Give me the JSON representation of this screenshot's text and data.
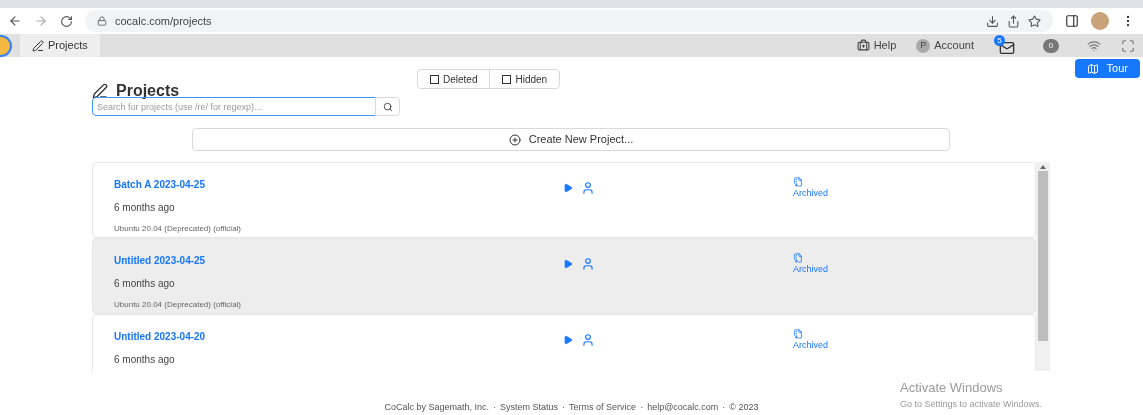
{
  "browser": {
    "url": "cocalc.com/projects"
  },
  "app_bar": {
    "tab": "Projects",
    "help": "Help",
    "account_initial": "P",
    "account": "Account",
    "mail_count": "5",
    "badge": "0"
  },
  "tour_button": "Tour",
  "page": {
    "title": "Projects",
    "search": {
      "placeholder": "Search for projects (use /re/ for regexp)..."
    },
    "filters": [
      {
        "label": "Deleted",
        "checked": false
      },
      {
        "label": "Hidden",
        "checked": false
      }
    ],
    "create_button": "Create New Project..."
  },
  "projects": [
    {
      "title": "Batch A 2023-04-25",
      "modified": "6 months ago",
      "image": "Ubuntu 20.04 (Deprecated) (official)",
      "status": "Archived",
      "selected": false
    },
    {
      "title": "Untitled 2023-04-25",
      "modified": "6 months ago",
      "image": "Ubuntu 20.04 (Deprecated) (official)",
      "status": "Archived",
      "selected": true
    },
    {
      "title": "Untitled 2023-04-20",
      "modified": "6 months ago",
      "status": "Archived",
      "selected": false
    }
  ],
  "os_notice": {
    "title": "Activate Windows",
    "text": "Go to Settings to activate Windows."
  },
  "footer": {
    "separator": "·",
    "links": [
      "CoCalc by Sagemath, Inc.",
      "System Status",
      "Terms of Service",
      "help@cocalc.com",
      "© 2023"
    ]
  }
}
